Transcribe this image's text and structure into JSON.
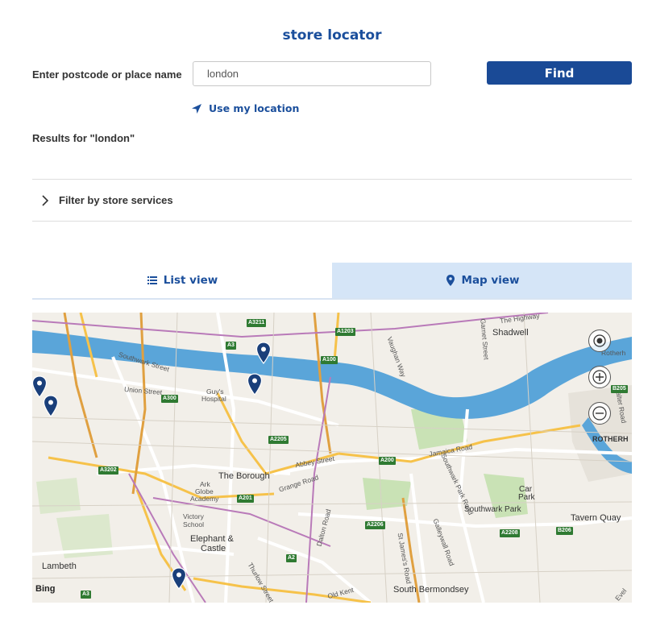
{
  "page": {
    "title": "store locator"
  },
  "search": {
    "label": "Enter postcode or place name",
    "value": "london",
    "find_label": "Find",
    "use_location_label": "Use my location"
  },
  "results": {
    "text": "Results for \"london\""
  },
  "filter": {
    "label": "Filter by store services"
  },
  "tabs": [
    {
      "label": "List view",
      "icon": "list-icon",
      "active": false
    },
    {
      "label": "Map view",
      "icon": "map-pin-icon",
      "active": true
    }
  ],
  "map": {
    "attribution": "Bing",
    "places": {
      "shadwell": "Shadwell",
      "the_borough": "The Borough",
      "elephant": "Elephant &",
      "castle": "Castle",
      "lambeth": "Lambeth",
      "south_bermondsey": "South Bermondsey",
      "tavern_quay": "Tavern Quay",
      "southwark_park": "Southwark Park",
      "car": "Car",
      "park": "Park",
      "guys": "Guy's",
      "hospital": "Hospital",
      "ark": "Ark",
      "globe": "Globe",
      "academy": "Academy",
      "victory": "Victory",
      "school": "School",
      "rotherh": "ROTHERH",
      "rotherh_small": "Rotherh"
    },
    "streets": {
      "southwark": "Southwark Street",
      "union": "Union Street",
      "jamaica": "Jamaica Road",
      "grange": "Grange Road",
      "abbey": "Abbey Street",
      "highway": "The Highway",
      "salter": "Salter Road",
      "old_kent": "Old Kent",
      "dalton": "Dalton Road",
      "jamess": "St James's Road",
      "galleywall": "Galleywall Road",
      "thurlow": "Thurlow Street",
      "southwark_park_rd": "Southwark Park Road",
      "vaughan": "Vaughan Way",
      "garnet": "Garnet Street",
      "evel": "Evel"
    },
    "roads": [
      "A3211",
      "A1203",
      "A3",
      "A100",
      "A300",
      "A2205",
      "A3202",
      "A201",
      "A200",
      "A2206",
      "A2208",
      "B206",
      "A2",
      "A3",
      "B205"
    ]
  },
  "colors": {
    "accent": "#1b4f9c",
    "button": "#1a4a96",
    "tab_active": "#d5e5f7",
    "water": "#5aa5d9",
    "park": "#c9e2b5"
  }
}
